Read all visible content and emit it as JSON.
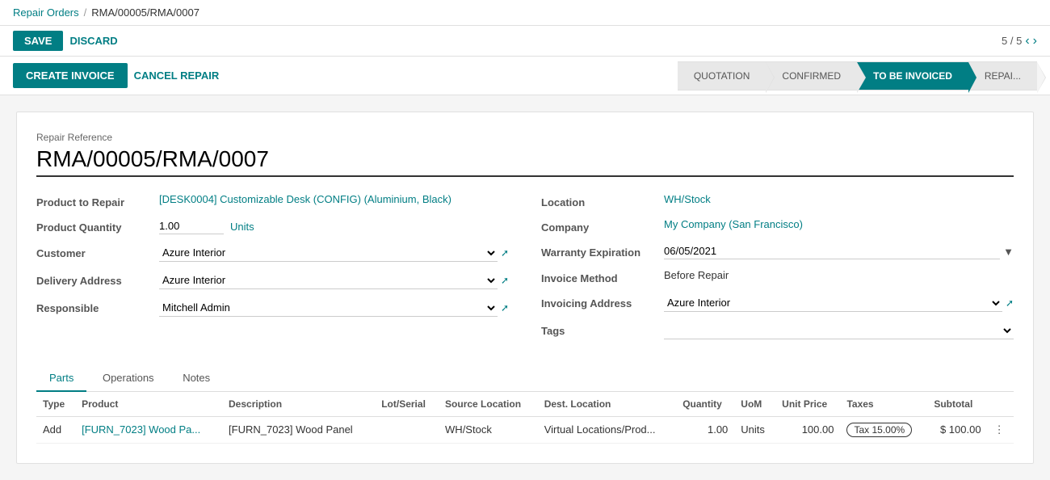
{
  "breadcrumb": {
    "parent_label": "Repair Orders",
    "separator": "/",
    "current_label": "RMA/00005/RMA/0007"
  },
  "action_bar": {
    "save_label": "SAVE",
    "discard_label": "DISCARD",
    "pagination_current": "5",
    "pagination_total": "5"
  },
  "status_bar": {
    "create_invoice_label": "CREATE INVOICE",
    "cancel_repair_label": "CANCEL REPAIR",
    "steps": [
      {
        "label": "QUOTATION",
        "state": "done"
      },
      {
        "label": "CONFIRMED",
        "state": "done"
      },
      {
        "label": "TO BE INVOICED",
        "state": "active"
      },
      {
        "label": "REPAI...",
        "state": "default"
      }
    ]
  },
  "form": {
    "repair_reference_label": "Repair Reference",
    "repair_reference_value": "RMA/00005/RMA/0007",
    "left_fields": [
      {
        "label": "Product to Repair",
        "value": "[DESK0004] Customizable Desk (CONFIG) (Aluminium, Black)",
        "type": "link"
      },
      {
        "label": "Product Quantity",
        "value": "1.00",
        "unit": "Units",
        "type": "input"
      },
      {
        "label": "Customer",
        "value": "Azure Interior",
        "type": "select"
      },
      {
        "label": "Delivery Address",
        "value": "Azure Interior",
        "type": "select"
      },
      {
        "label": "Responsible",
        "value": "Mitchell Admin",
        "type": "select"
      }
    ],
    "right_fields": [
      {
        "label": "Location",
        "value": "WH/Stock",
        "type": "link"
      },
      {
        "label": "Company",
        "value": "My Company (San Francisco)",
        "type": "link"
      },
      {
        "label": "Warranty Expiration",
        "value": "06/05/2021",
        "type": "date"
      },
      {
        "label": "Invoice Method",
        "value": "Before Repair",
        "type": "text"
      },
      {
        "label": "Invoicing Address",
        "value": "Azure Interior",
        "type": "select-link"
      },
      {
        "label": "Tags",
        "value": "",
        "type": "select"
      }
    ]
  },
  "tabs": [
    {
      "label": "Parts",
      "active": true
    },
    {
      "label": "Operations",
      "active": false
    },
    {
      "label": "Notes",
      "active": false
    }
  ],
  "table": {
    "columns": [
      "Type",
      "Product",
      "Description",
      "Lot/Serial",
      "Source Location",
      "Dest. Location",
      "Quantity",
      "UoM",
      "Unit Price",
      "Taxes",
      "Subtotal"
    ],
    "rows": [
      {
        "type": "Add",
        "product": "[FURN_7023] Wood Pa...",
        "description": "[FURN_7023] Wood Panel",
        "lot_serial": "",
        "source_location": "WH/Stock",
        "dest_location": "Virtual Locations/Prod...",
        "quantity": "1.00",
        "uom": "Units",
        "unit_price": "100.00",
        "taxes": "Tax 15.00%",
        "subtotal": "$ 100.00"
      }
    ]
  }
}
